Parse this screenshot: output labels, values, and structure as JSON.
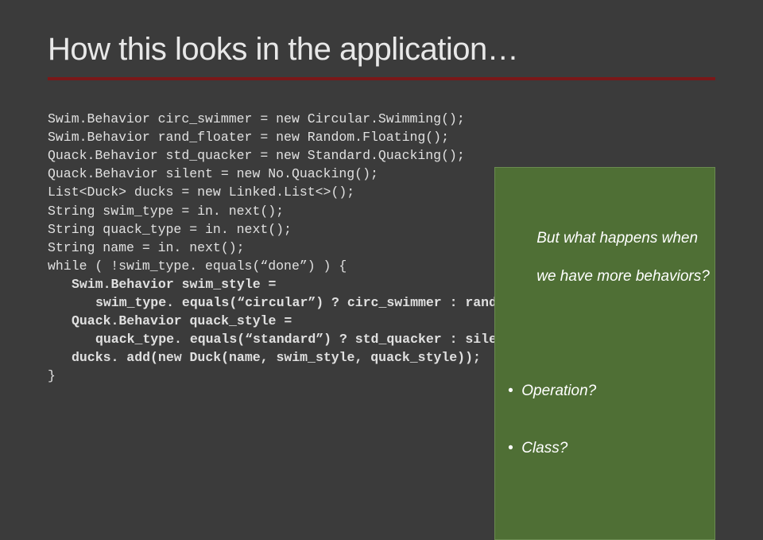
{
  "title": "How this looks in the application…",
  "code": {
    "l1": "Swim.Behavior circ_swimmer = new Circular.Swimming();",
    "l2": "Swim.Behavior rand_floater = new Random.Floating();",
    "l3": "Quack.Behavior std_quacker = new Standard.Quacking();",
    "l4": "Quack.Behavior silent = new No.Quacking();",
    "l5": "List<Duck> ducks = new Linked.List<>();",
    "l6": "String swim_type = in. next();",
    "l7": "String quack_type = in. next();",
    "l8": "String name = in. next();",
    "l9": "while ( !swim_type. equals(“done”) ) {",
    "l10a": "Swim.Behavior swim_style =",
    "l10b": "swim_type. equals(“circular”) ? circ_swimmer : rand_floater;",
    "l11a": "Quack.Behavior quack_style =",
    "l11b": "quack_type. equals(“standard”) ? std_quacker : silent;",
    "l12": "ducks. add(new Duck(name, swim_style, quack_style));",
    "l13": "}"
  },
  "callout": {
    "line1": "But what happens when",
    "line2": "we have more behaviors?",
    "bullet1": "Operation?",
    "bullet2": "Class?"
  }
}
